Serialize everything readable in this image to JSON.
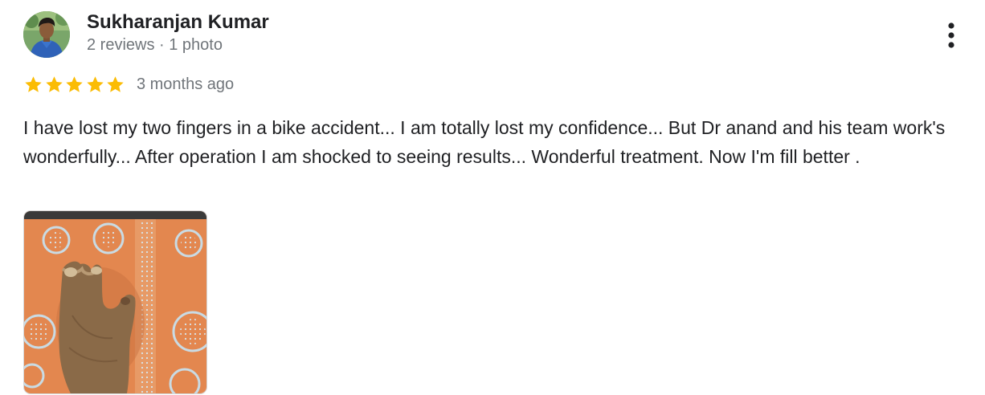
{
  "reviewer": {
    "name": "Sukharanjan Kumar",
    "meta": "2 reviews · 1 photo",
    "avatar_icon": "user-photo-avatar"
  },
  "rating": {
    "stars": 5,
    "max_stars": 5,
    "star_color": "#fbbc04",
    "date": "3 months ago"
  },
  "review": {
    "text": "I have lost my two fingers in a bike accident... I am totally lost my confidence... But Dr anand and his team work's wonderfully... After operation I am shocked to seeing results... Wonderful treatment. Now I'm fill better ."
  },
  "actions": {
    "more_icon": "more-vert-icon"
  },
  "photo": {
    "icon": "review-photo-thumbnail",
    "accent_color": "#e3874f"
  }
}
